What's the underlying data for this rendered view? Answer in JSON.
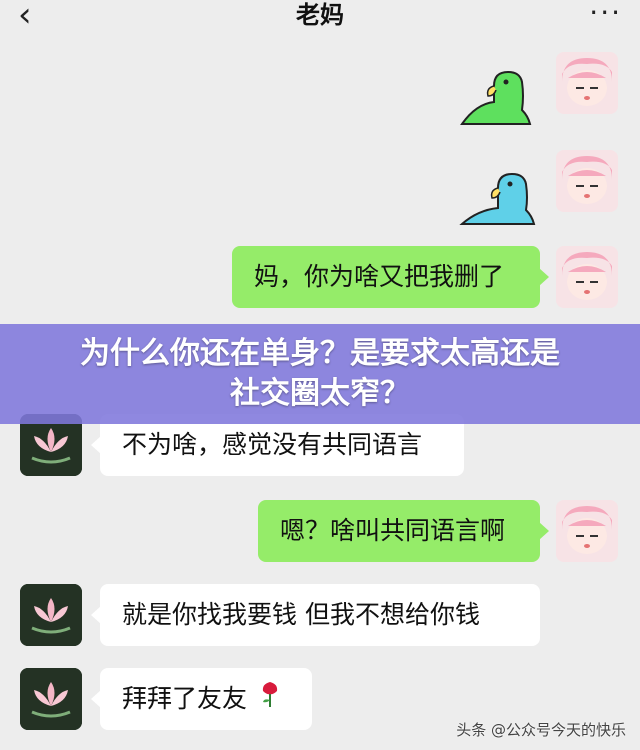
{
  "header": {
    "back_icon": "chevron-left-icon",
    "title": "老妈",
    "more_icon": "more-dots-icon"
  },
  "messages": [
    {
      "side": "out",
      "kind": "sticker",
      "sticker": "green-parrot-sticker"
    },
    {
      "side": "out",
      "kind": "sticker",
      "sticker": "blue-parrot-sticker"
    },
    {
      "side": "out",
      "kind": "text",
      "text": "妈，你为啥又把我删了"
    },
    {
      "side": "in",
      "kind": "text",
      "text": "不为啥，感觉没有共同语言"
    },
    {
      "side": "out",
      "kind": "text",
      "text": "嗯？啥叫共同语言啊"
    },
    {
      "side": "in",
      "kind": "text",
      "text": "就是你找我要钱  但我不想给你钱"
    },
    {
      "side": "in",
      "kind": "text",
      "text": "拜拜了友友",
      "emoji": "rose-icon"
    }
  ],
  "overlay": {
    "line1": "为什么你还在单身？是要求太高还是",
    "line2": "社交圈太窄？",
    "color": "#7f79dd"
  },
  "watermark": "头条 @公众号今天的快乐"
}
